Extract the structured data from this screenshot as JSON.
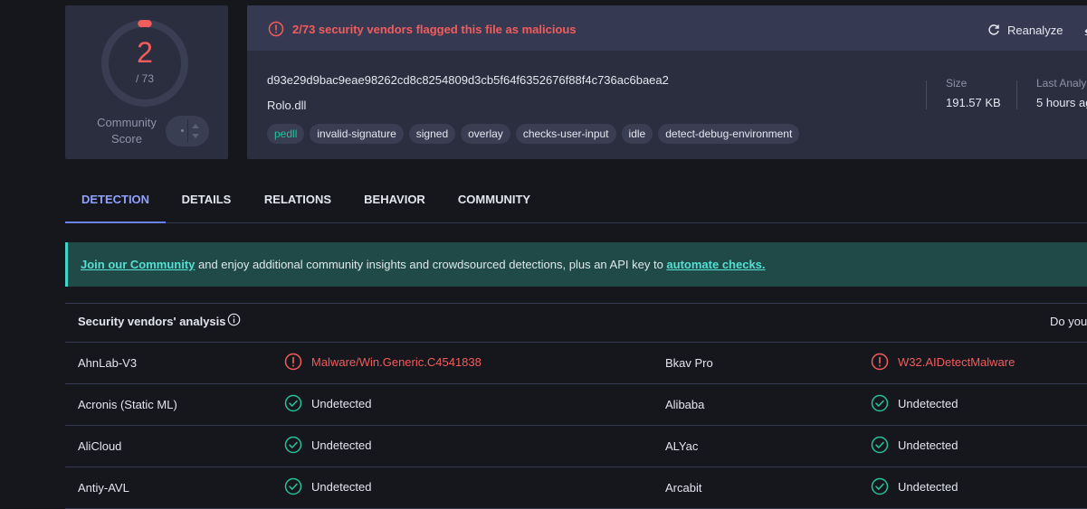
{
  "score": {
    "detections": "2",
    "total": "/ 73",
    "community_label": "Community Score",
    "malicious_fraction": 0.027
  },
  "alert": {
    "text": "2/73 security vendors flagged this file as malicious"
  },
  "actions": {
    "reanalyze": "Reanalyze"
  },
  "file": {
    "hash": "d93e29d9bac9eae98262cd8c8254809d3cb5f64f6352676f88f4c736ac6baea2",
    "name": "Rolo.dll",
    "tags": [
      "pedll",
      "invalid-signature",
      "signed",
      "overlay",
      "checks-user-input",
      "idle",
      "detect-debug-environment"
    ]
  },
  "meta": {
    "size_label": "Size",
    "size_value": "191.57 KB",
    "last_label": "Last Analy",
    "last_value": "5 hours ag"
  },
  "tabs": [
    "DETECTION",
    "DETAILS",
    "RELATIONS",
    "BEHAVIOR",
    "COMMUNITY"
  ],
  "active_tab": "DETECTION",
  "banner": {
    "link1": "Join our Community",
    "middle": " and enjoy additional community insights and crowdsourced detections, plus an API key to ",
    "link2": "automate checks."
  },
  "vendors_header": {
    "title": "Security vendors' analysis",
    "right": "Do you"
  },
  "vendors": [
    {
      "left": {
        "name": "AhnLab-V3",
        "result": "Malware/Win.Generic.C4541838",
        "malicious": true
      },
      "right": {
        "name": "Bkav Pro",
        "result": "W32.AIDetectMalware",
        "malicious": true
      }
    },
    {
      "left": {
        "name": "Acronis (Static ML)",
        "result": "Undetected",
        "malicious": false
      },
      "right": {
        "name": "Alibaba",
        "result": "Undetected",
        "malicious": false
      }
    },
    {
      "left": {
        "name": "AliCloud",
        "result": "Undetected",
        "malicious": false
      },
      "right": {
        "name": "ALYac",
        "result": "Undetected",
        "malicious": false
      }
    },
    {
      "left": {
        "name": "Antiy-AVL",
        "result": "Undetected",
        "malicious": false
      },
      "right": {
        "name": "Arcabit",
        "result": "Undetected",
        "malicious": false
      }
    }
  ],
  "colors": {
    "malicious": "#f25c5c",
    "clean": "#27c09a",
    "accent": "#6b82ff",
    "banner_link": "#55e0d3"
  }
}
